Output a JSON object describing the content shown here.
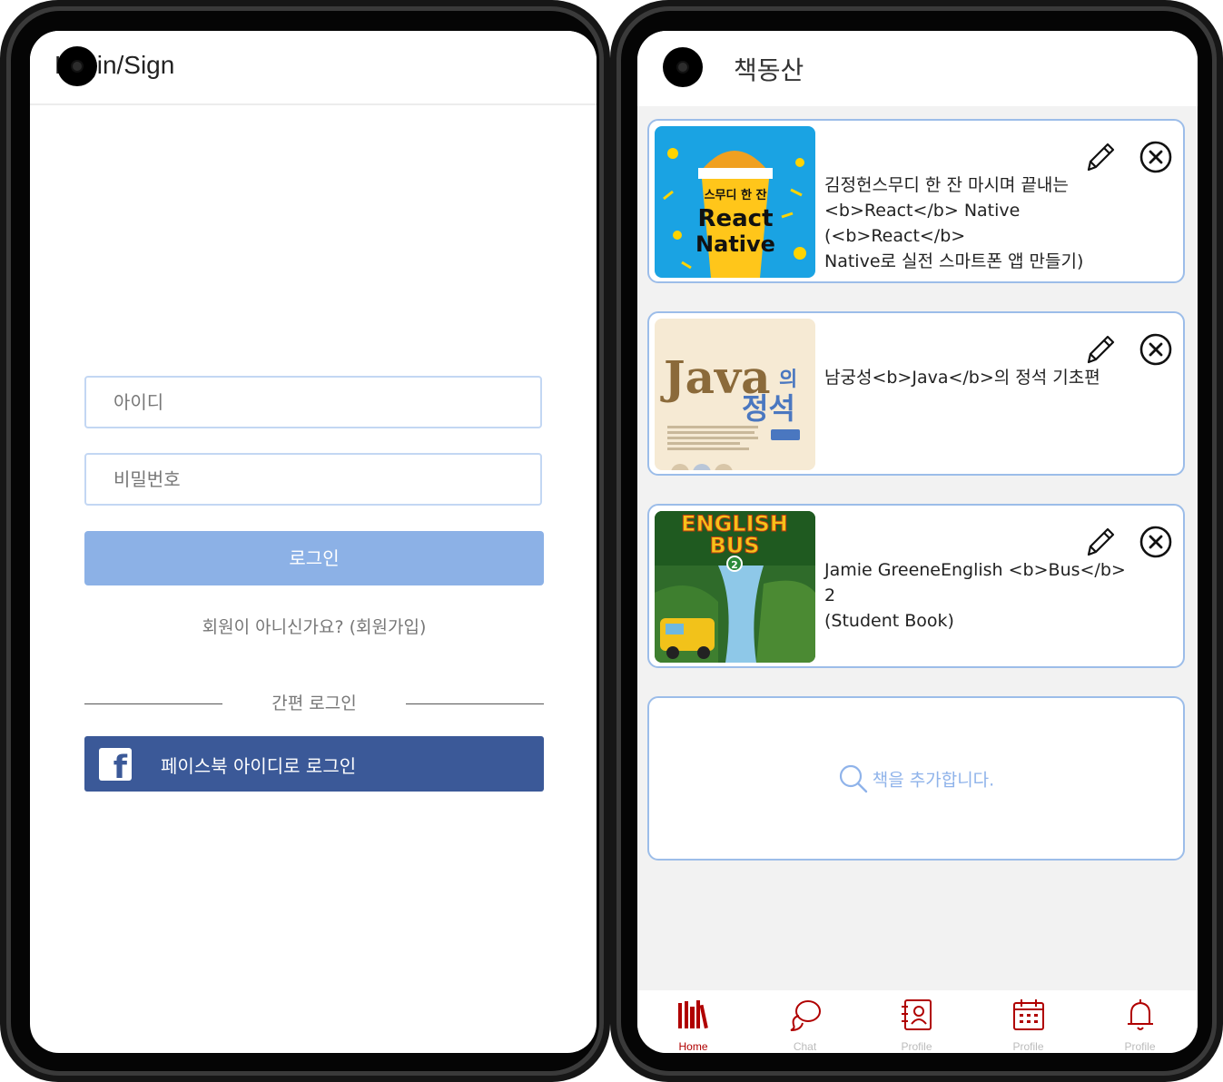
{
  "login_screen": {
    "header_title": "Login/Sign",
    "id_placeholder": "아이디",
    "password_placeholder": "비밀번호",
    "login_button": "로그인",
    "signup_prompt": "회원이 아니신가요? (회원가입)",
    "easy_login_label": "간편 로그인",
    "facebook_button": "페이스북 아이디로 로그인",
    "facebook_icon": "facebook-icon"
  },
  "home_screen": {
    "header_title": "책동산",
    "books": [
      {
        "title_line1": "김정헌스무디 한 잔 마시며 끝내는",
        "title_line2": "<b>React</b> Native (<b>React</b>",
        "title_line3": "Native로 실전 스마트폰 앱 만들기)"
      },
      {
        "title_line1": "남궁성<b>Java</b>의 정석 기초편",
        "title_line2": "",
        "title_line3": ""
      },
      {
        "title_line1": "Jamie GreeneEnglish <b>Bus</b> 2",
        "title_line2": "(Student Book)",
        "title_line3": ""
      }
    ],
    "add_book_label": "책을 추가합니다.",
    "tabs": [
      {
        "label": "Home",
        "icon": "bookshelf-icon",
        "active": true
      },
      {
        "label": "Chat",
        "icon": "chat-icon",
        "active": false
      },
      {
        "label": "Profile",
        "icon": "contact-book-icon",
        "active": false
      },
      {
        "label": "Profile",
        "icon": "calendar-icon",
        "active": false
      },
      {
        "label": "Profile",
        "icon": "bell-icon",
        "active": false
      }
    ]
  },
  "colors": {
    "accent_blue": "#8cb1e6",
    "card_border": "#9cbde9",
    "facebook_blue": "#3b5998",
    "active_tab": "#b00000"
  }
}
